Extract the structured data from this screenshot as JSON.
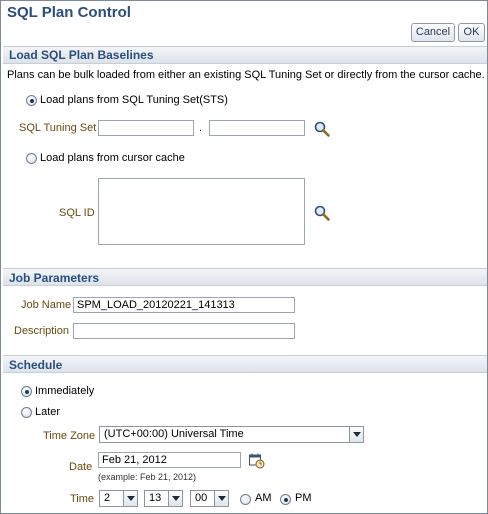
{
  "page": {
    "title": "SQL Plan Control",
    "cancel_label": "Cancel",
    "ok_label": "OK"
  },
  "load_section": {
    "title": "Load SQL Plan Baselines",
    "description": "Plans can be bulk loaded from either an existing SQL Tuning Set or directly from the cursor cache.",
    "option_sts_label": "Load plans from SQL Tuning Set(STS)",
    "option_sts_selected": true,
    "sts_label": "SQL Tuning Set",
    "sts_owner_value": "",
    "sts_name_value": "",
    "sts_separator": ".",
    "option_cursor_label": "Load plans from cursor cache",
    "option_cursor_selected": false,
    "sql_id_label": "SQL ID",
    "sql_id_value": ""
  },
  "job_section": {
    "title": "Job Parameters",
    "job_name_label": "Job Name",
    "job_name_value": "SPM_LOAD_20120221_141313",
    "description_label": "Description",
    "description_value": ""
  },
  "schedule_section": {
    "title": "Schedule",
    "immediately_label": "Immediately",
    "immediately_selected": true,
    "later_label": "Later",
    "later_selected": false,
    "time_zone_label": "Time Zone",
    "time_zone_value": "(UTC+00:00) Universal Time",
    "date_label": "Date",
    "date_value": "Feb 21, 2012",
    "date_example": "(example: Feb 21, 2012)",
    "time_label": "Time",
    "hour_value": "2",
    "minute_value": "13",
    "second_value": "00",
    "am_label": "AM",
    "pm_label": "PM",
    "pm_selected": true
  },
  "icons": {
    "search": "magnifier-icon",
    "calendar": "calendar-clock-icon",
    "dropdown": "chevron-down-icon"
  }
}
